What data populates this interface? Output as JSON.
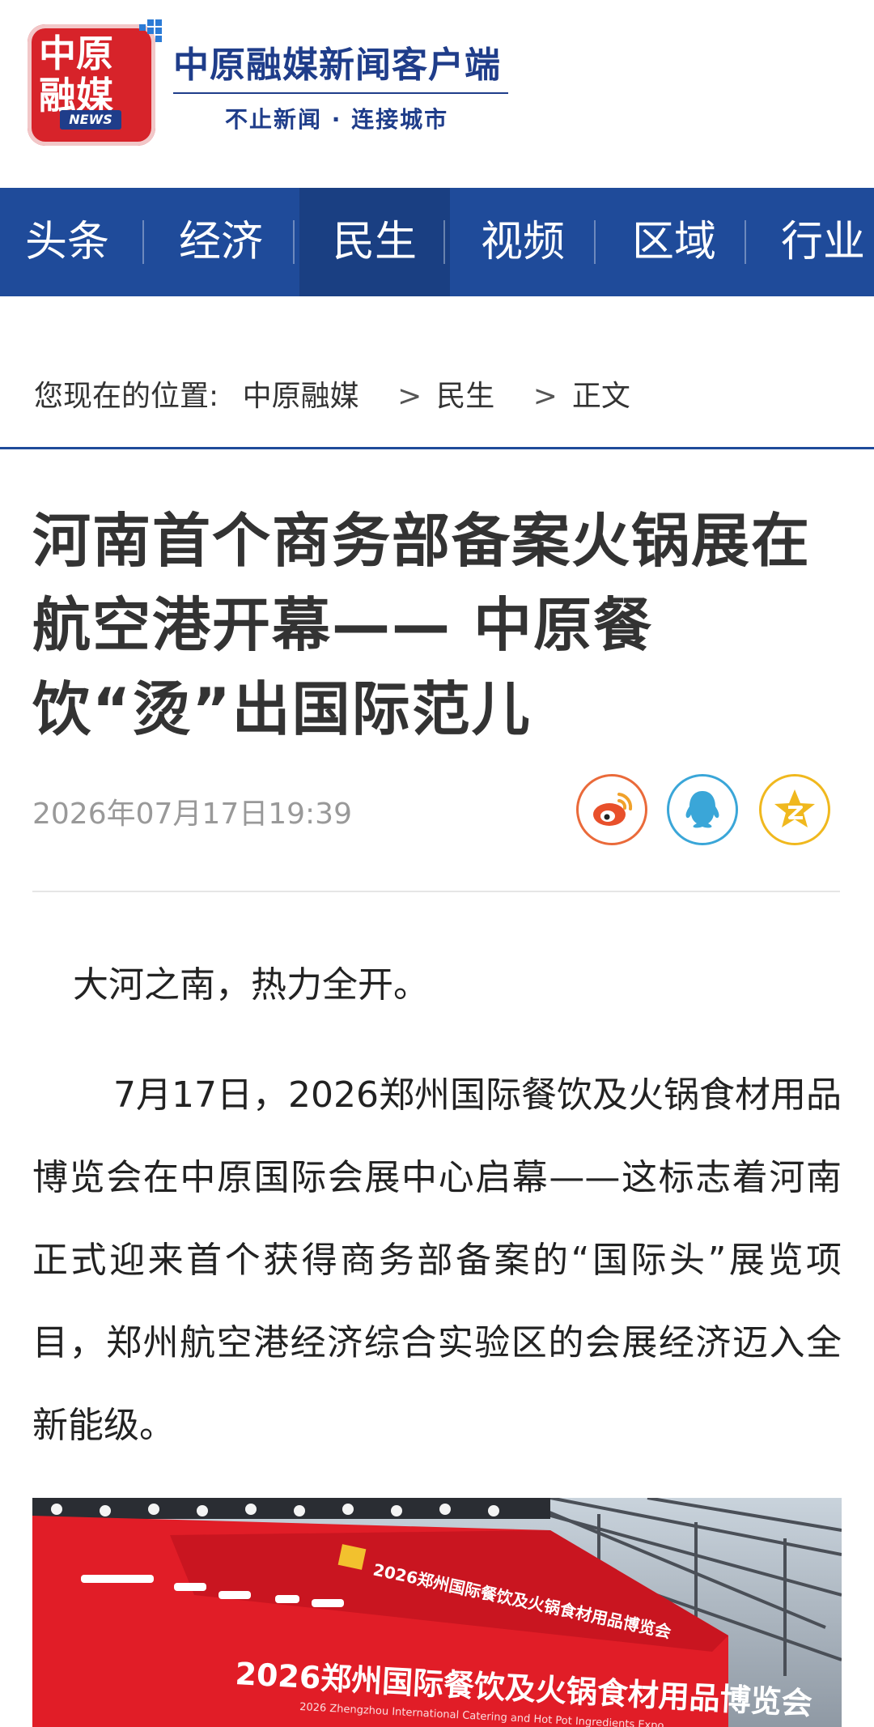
{
  "brand": {
    "logo_line1": "中原",
    "logo_line2": "融媒",
    "logo_news": "NEWS",
    "title": "中原融媒新闻客户端",
    "subtitle": "不止新闻 · 连接城市"
  },
  "nav": {
    "items": [
      {
        "label": "头条",
        "active": false
      },
      {
        "label": "经济",
        "active": false
      },
      {
        "label": "民生",
        "active": true
      },
      {
        "label": "视频",
        "active": false
      },
      {
        "label": "区域",
        "active": false
      },
      {
        "label": "行业",
        "active": false
      }
    ]
  },
  "breadcrumb": {
    "prefix": "您现在的位置:",
    "items": [
      "中原融媒",
      "民生",
      "正文"
    ],
    "separator": ">"
  },
  "article": {
    "title": "河南首个商务部备案火锅展在航空港开幕—— 中原餐饮“烫”出国际范儿",
    "date": "2026年07月17日19:39",
    "paragraphs": [
      "大河之南，热力全开。",
      "7月17日，2026郑州国际餐饮及火锅食材用品博览会在中原国际会展中心启幕——这标志着河南正式迎来首个获得商务部备案的“国际头”展览项目，郑州航空港经济综合实验区的会展经济迈入全新能级。"
    ]
  },
  "share": {
    "buttons": [
      "weibo-icon",
      "qq-icon",
      "qzone-icon"
    ]
  },
  "photo": {
    "banner_main": "2026郑州国际餐饮及火锅食材用品博览会",
    "banner_sub": "2026 Zhengzhou International Catering and Hot Pot Ingredients Expo"
  },
  "colors": {
    "brand_blue": "#1f4b9a",
    "logo_red": "#d7232a"
  }
}
